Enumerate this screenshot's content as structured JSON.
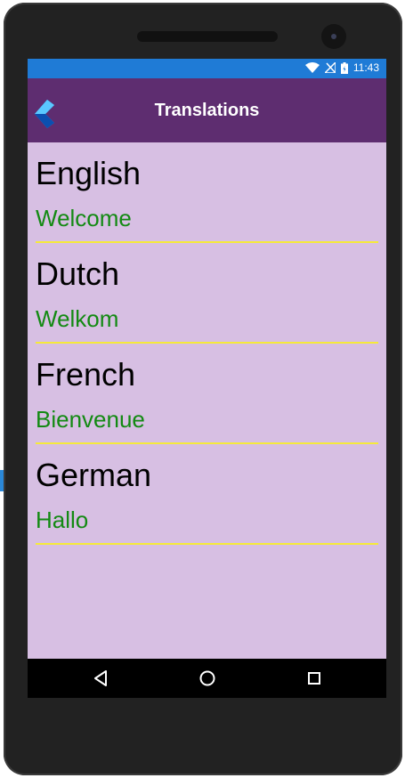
{
  "status_bar": {
    "time": "11:43",
    "icons": [
      "wifi-icon",
      "signal-icon",
      "battery-icon"
    ],
    "color": "#1f7bd6"
  },
  "app_bar": {
    "title": "Translations",
    "logo": "app-logo-icon",
    "color": "#5e2d70"
  },
  "list": {
    "background": "#d7bfe3",
    "separator_color": "#f5ea3a",
    "translation_color": "#138a13",
    "items": [
      {
        "language": "English",
        "translation": "Welcome"
      },
      {
        "language": "Dutch",
        "translation": "Welkom"
      },
      {
        "language": "French",
        "translation": "Bienvenue"
      },
      {
        "language": "German",
        "translation": "Hallo"
      }
    ]
  },
  "nav_bar": {
    "buttons": [
      "back-icon",
      "home-icon",
      "recents-icon"
    ]
  }
}
